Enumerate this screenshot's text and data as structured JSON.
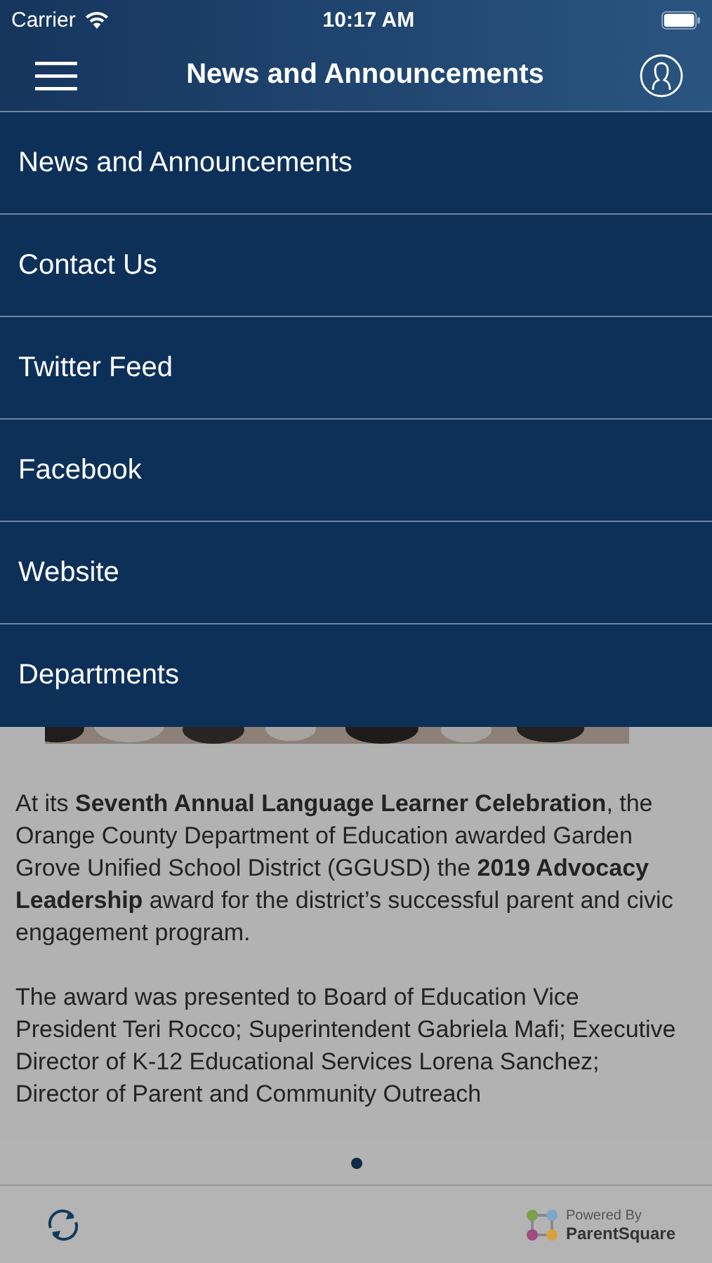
{
  "status_bar": {
    "carrier": "Carrier",
    "time": "10:17 AM"
  },
  "header": {
    "title": "News and Announcements"
  },
  "menu": {
    "items": [
      {
        "label": "News and Announcements"
      },
      {
        "label": "Contact Us"
      },
      {
        "label": "Twitter Feed"
      },
      {
        "label": "Facebook"
      },
      {
        "label": "Website"
      },
      {
        "label": "Departments"
      }
    ]
  },
  "article": {
    "paragraphs": [
      "At its **Seventh Annual Language Learner Celebration**, the Orange County Department of Education awarded Garden Grove Unified School District (GGUSD) the **2019 Advocacy Leadership** award for the district’s successful parent and civic engagement program.",
      "The award was presented to Board of Education Vice President Teri Rocco; Superintendent Gabriela Mafi; Executive Director of K-12 Educational Services Lorena Sanchez; Director of Parent and Community Outreach"
    ]
  },
  "pager": {
    "pages": [
      {
        "selected": true
      }
    ]
  },
  "footer": {
    "powered_by": "Powered By",
    "brand": "ParentSquare"
  }
}
